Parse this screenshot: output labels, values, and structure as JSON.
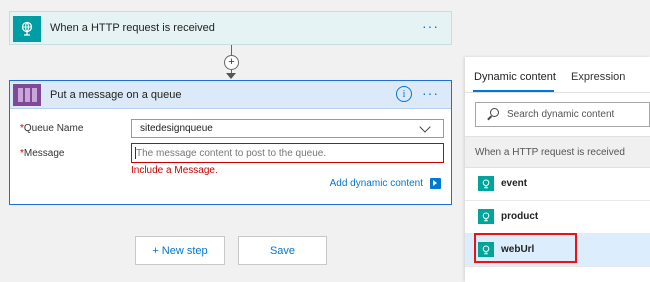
{
  "trigger": {
    "title": "When a HTTP request is received",
    "more": "···"
  },
  "connector": {
    "plus": "+"
  },
  "action": {
    "title": "Put a message on a queue",
    "info": "i",
    "more": "···",
    "queue_name": {
      "required_mark": "*",
      "label": "Queue Name",
      "value": "sitedesignqueue"
    },
    "message": {
      "required_mark": "*",
      "label": "Message",
      "placeholder": "The message content to post to the queue.",
      "error": "Include a Message."
    },
    "add_dynamic_content": "Add dynamic content"
  },
  "footer": {
    "new_step": "+ New step",
    "save": "Save"
  },
  "panel": {
    "tabs": [
      "Dynamic content",
      "Expression"
    ],
    "active_tab": "Dynamic content",
    "search_placeholder": "Search dynamic content",
    "group_header": "When a HTTP request is received",
    "tokens": [
      {
        "label": "event"
      },
      {
        "label": "product"
      },
      {
        "label": "webUrl"
      }
    ],
    "selected_token": "webUrl"
  },
  "colors": {
    "accent": "#0078d4",
    "trigger_icon": "#009da5",
    "queue_icon": "#804998",
    "error": "#cc0000",
    "highlight": "#ee1111"
  }
}
